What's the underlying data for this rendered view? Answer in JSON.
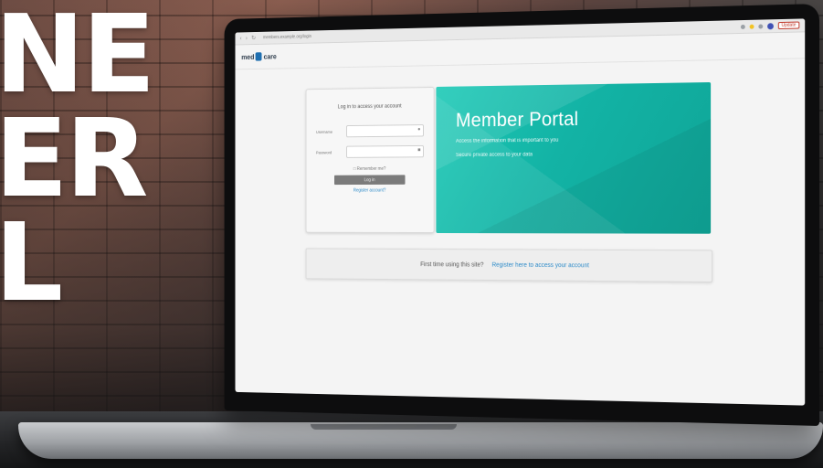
{
  "overlay": {
    "lines": [
      "NE",
      "ER",
      "L"
    ]
  },
  "browser": {
    "url": "members.example.org/login",
    "nav_back": "‹",
    "nav_forward": "›",
    "nav_reload": "↻",
    "extension_label": "Update"
  },
  "site": {
    "logo_text_left": "med",
    "logo_text_right": "care"
  },
  "login": {
    "title": "Log in to access your account",
    "username_label": "Username",
    "password_label": "Password",
    "remember_label": "Remember me?",
    "login_button": "Log in",
    "register_link": "Register account?"
  },
  "portal": {
    "title": "Member Portal",
    "line1": "Access the information that is important to you",
    "line2": "Secure private access to your data"
  },
  "first_time": {
    "text": "First time using this site?",
    "link": "Register here to access your account"
  },
  "colors": {
    "portal_teal": "#13b3a5",
    "link_blue": "#2a89c8"
  }
}
